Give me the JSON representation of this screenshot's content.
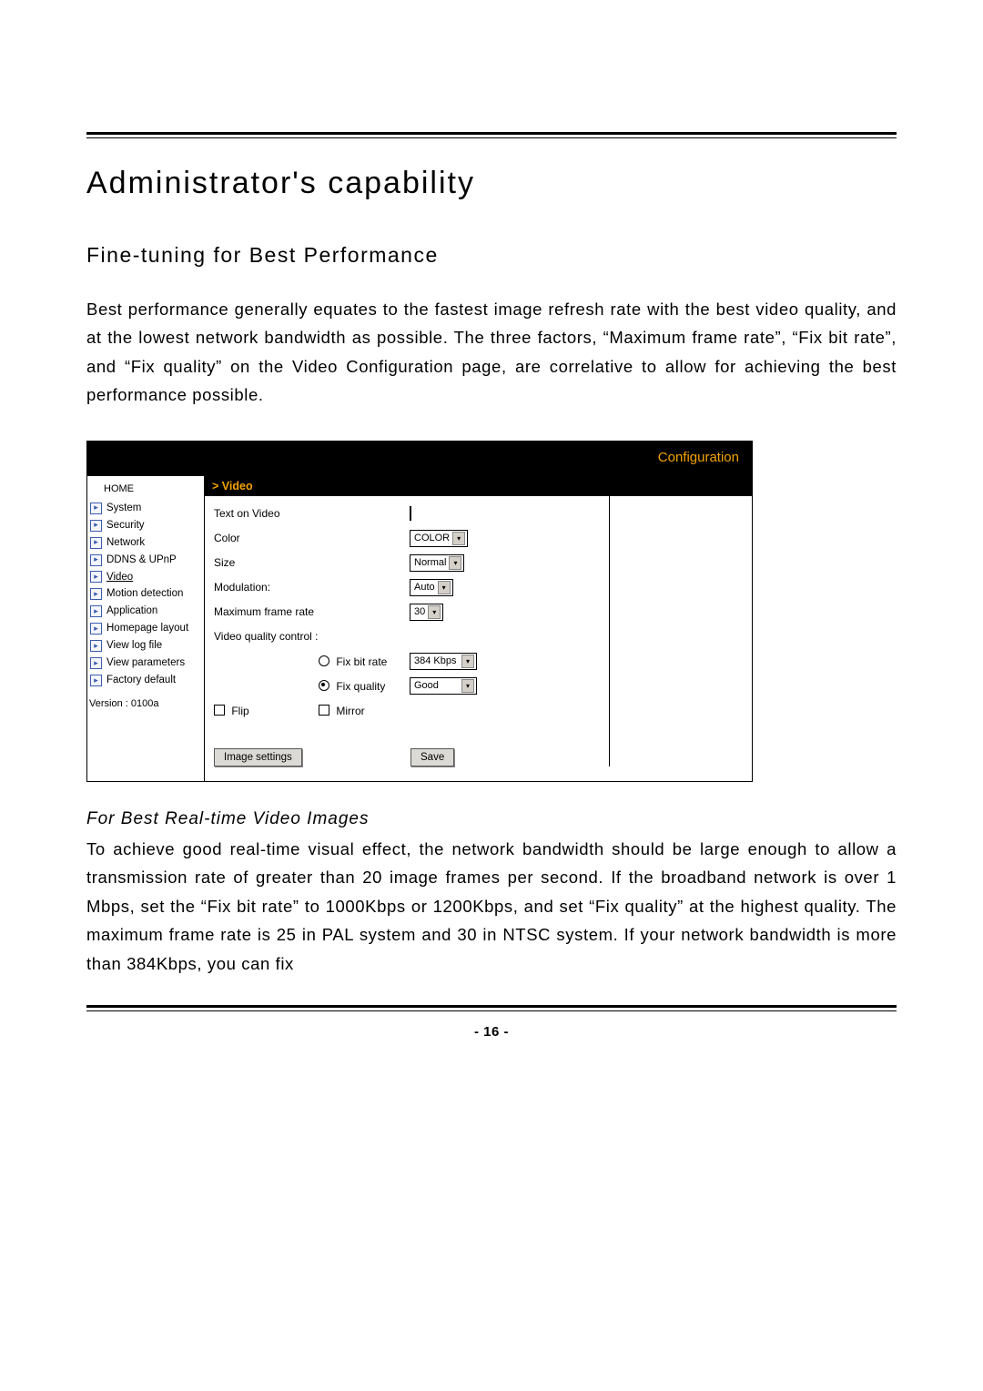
{
  "headings": {
    "title": "Administrator's capability",
    "subtitle": "Fine-tuning for Best Performance",
    "sub2": "For Best Real-time Video Images"
  },
  "paragraphs": {
    "p1": "Best performance generally equates to the fastest image refresh rate with the best video quality, and at the lowest network bandwidth as possible. The three factors, “Maximum frame rate”, “Fix bit rate”, and “Fix quality” on the Video Configuration page, are correlative to allow for achieving the best performance possible.",
    "p2": "To achieve good real-time visual effect, the network bandwidth should be large enough to allow a transmission rate of greater than 20 image frames per second. If the broadband network is over 1 Mbps, set the “Fix bit rate” to 1000Kbps or 1200Kbps, and set “Fix quality” at the highest quality. The maximum frame rate is 25 in PAL system and 30 in NTSC system. If your network bandwidth is more than 384Kbps, you can fix"
  },
  "page_number": "- 16 -",
  "panel": {
    "header_tab": "Configuration",
    "sidebar": {
      "home": "HOME",
      "items": [
        {
          "label": "System"
        },
        {
          "label": "Security"
        },
        {
          "label": "Network"
        },
        {
          "label": "DDNS & UPnP"
        },
        {
          "label": "Video",
          "active": true
        },
        {
          "label": "Motion detection"
        },
        {
          "label": "Application"
        },
        {
          "label": "Homepage layout"
        },
        {
          "label": "View log file"
        },
        {
          "label": "View parameters"
        },
        {
          "label": "Factory default"
        }
      ],
      "version": "Version : 0100a"
    },
    "main": {
      "title": "> Video",
      "rows": {
        "text_on_video": {
          "label": "Text on Video",
          "value": ""
        },
        "color": {
          "label": "Color",
          "value": "COLOR"
        },
        "size": {
          "label": "Size",
          "value": "Normal"
        },
        "modulation": {
          "label": "Modulation:",
          "value": "Auto"
        },
        "max_frame": {
          "label": "Maximum frame rate",
          "value": "30"
        },
        "vqc_label": "Video quality control :",
        "fix_bit": {
          "label": "Fix bit rate",
          "value": "384 Kbps",
          "checked": false
        },
        "fix_quality": {
          "label": "Fix quality",
          "value": "Good",
          "checked": true
        },
        "flip_label": "Flip",
        "mirror_label": "Mirror"
      },
      "buttons": {
        "image_settings": "Image settings",
        "save": "Save"
      }
    }
  }
}
